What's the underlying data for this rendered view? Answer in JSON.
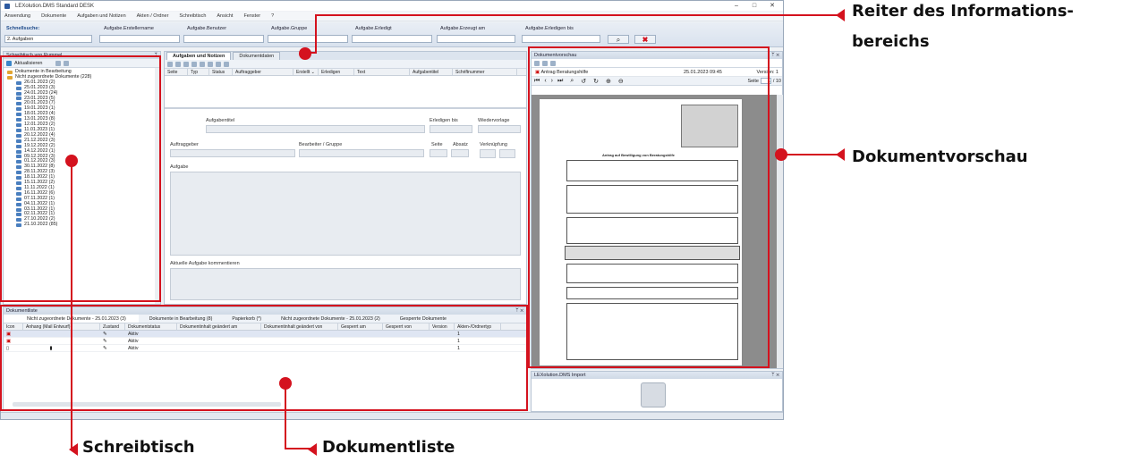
{
  "app": {
    "title": "LEXolution.DMS Standard DESK"
  },
  "window_buttons": {
    "minimize": "–",
    "maximize": "□",
    "close": "✕"
  },
  "menu": [
    "Anwendung",
    "Dokumente",
    "Aufgaben und Notizen",
    "Akten / Ordner",
    "Schreibtisch",
    "Ansicht",
    "Fenster",
    "?"
  ],
  "filter": {
    "title": "Schnellsuche:",
    "search_value": "2. Aufgaben",
    "labels": [
      "Aufgabe.Erstellername",
      "Aufgabe.Benutzer",
      "Aufgabe.Gruppe",
      "Aufgabe.Erledigt",
      "Aufgabe.Erzeugt am",
      "Aufgabe.Erledigen bis"
    ],
    "search_icon": "binoculars-icon",
    "clear_icon": "clear-x-icon"
  },
  "desk": {
    "title": "Schreibtisch von Rummel",
    "refresh": "Aktualisieren",
    "tree_root1": "Dokumente in Bearbeitung",
    "tree_root2": "Nicht zugeordnete Dokumente (228)",
    "dates": [
      "26.01.2023 (2)",
      "25.01.2023 (3)",
      "24.01.2023 (24)",
      "23.01.2023 (5)",
      "20.01.2023 (7)",
      "19.01.2023 (1)",
      "18.01.2023 (4)",
      "13.01.2023 (8)",
      "12.01.2023 (2)",
      "11.01.2023 (1)",
      "20.12.2022 (4)",
      "21.12.2022 (3)",
      "19.12.2022 (2)",
      "14.12.2022 (1)",
      "09.12.2022 (3)",
      "01.12.2022 (3)",
      "30.11.2022 (8)",
      "28.11.2022 (3)",
      "18.11.2022 (1)",
      "15.11.2022 (2)",
      "11.11.2022 (1)",
      "16.11.2022 (6)",
      "07.11.2022 (1)",
      "04.11.2022 (1)",
      "03.11.2022 (1)",
      "02.11.2022 (1)",
      "27.10.2022 (2)",
      "21.10.2022 (85)"
    ]
  },
  "info": {
    "tab_tasks": "Aufgaben und Notizen",
    "tab_docdata": "Dokumentdaten",
    "columns": [
      "Seite",
      "Typ",
      "Status",
      "Auftraggeber",
      "Erstellt ⌄",
      "Erledigen",
      "Text",
      "Aufgabentitel",
      "Schriftnummer"
    ],
    "aufgabentitel": "Aufgabentitel",
    "erledigen_bis": "Erledigen bis",
    "wiedervorlage": "Wiedervorlage",
    "auftraggeber": "Auftraggeber",
    "bearbeiter": "Bearbeiter / Gruppe",
    "seite": "Seite",
    "absatz": "Absatz",
    "verknuepfung": "Verknüpfung",
    "aufgabe": "Aufgabe",
    "kommentieren": "Aktuelle Aufgabe kommentieren"
  },
  "doclist": {
    "title": "Dokumentliste",
    "tabs": [
      "Nicht zugeordnete Dokumente - 25.01.2023 (3)",
      "Dokumente in Bearbeitung (8)",
      "Papierkorb (*)",
      "Nicht zugeordnete Dokumente - 25.01.2023 (2)",
      "Gesperrte Dokumente"
    ],
    "columns": [
      "Icon",
      "Anhang (Mail Entwurf)",
      "Zustand",
      "Dokumentstatus",
      "Dokumentinhalt geändert am",
      "Dokumentinhalt geändert von",
      "Gesperrt am",
      "Gesperrt von",
      "Version",
      "Akten-/Ordnertyp"
    ],
    "rows": [
      {
        "status": "Aktiv",
        "version": "1"
      },
      {
        "status": "Aktiv",
        "version": "1"
      },
      {
        "status": "Aktiv",
        "version": "1"
      }
    ]
  },
  "preview": {
    "title": "Dokumentvorschau",
    "doc_name": "Antrag Beratungshilfe",
    "date": "25.01.2023 09:45",
    "version": "Version: 1",
    "page_label": "Seite",
    "page_value": "1",
    "page_total": "/ 10",
    "doc_heading": "Antrag auf Bewilligung von Beratungshilfe"
  },
  "import": {
    "title": "LEXolution.DMS Import"
  },
  "annotations": {
    "tabs": "Reiter des Informations-",
    "tabs2": "bereichs",
    "preview": "Dokumentvorschau",
    "desk": "Schreibtisch",
    "list": "Dokumentliste"
  },
  "colors": {
    "accent": "#d4121e",
    "panel_header": "#cfd9e6"
  }
}
